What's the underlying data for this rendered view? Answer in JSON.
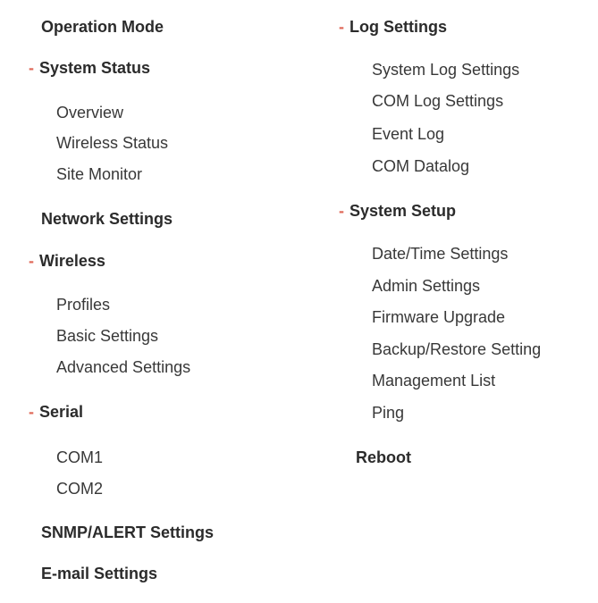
{
  "left": {
    "operation_mode": "Operation Mode",
    "system_status": {
      "label": "System Status",
      "items": [
        "Overview",
        "Wireless Status",
        "Site Monitor"
      ]
    },
    "network_settings": "Network Settings",
    "wireless": {
      "label": "Wireless",
      "items": [
        "Profiles",
        "Basic Settings",
        "Advanced Settings"
      ]
    },
    "serial": {
      "label": "Serial",
      "items": [
        "COM1",
        "COM2"
      ]
    },
    "snmp_alert": "SNMP/ALERT Settings",
    "email": "E-mail Settings"
  },
  "right": {
    "log_settings": {
      "label": "Log Settings",
      "items": [
        "System Log Settings",
        "COM Log Settings",
        "Event Log",
        "COM Datalog"
      ]
    },
    "system_setup": {
      "label": "System Setup",
      "items": [
        "Date/Time Settings",
        "Admin Settings",
        "Firmware Upgrade",
        "Backup/Restore Setting",
        "Management List",
        "Ping"
      ]
    },
    "reboot": "Reboot"
  },
  "expanded_marker": "-",
  "colors": {
    "marker": "#e06a5a",
    "heading": "#2b2b2b",
    "item": "#383838"
  }
}
